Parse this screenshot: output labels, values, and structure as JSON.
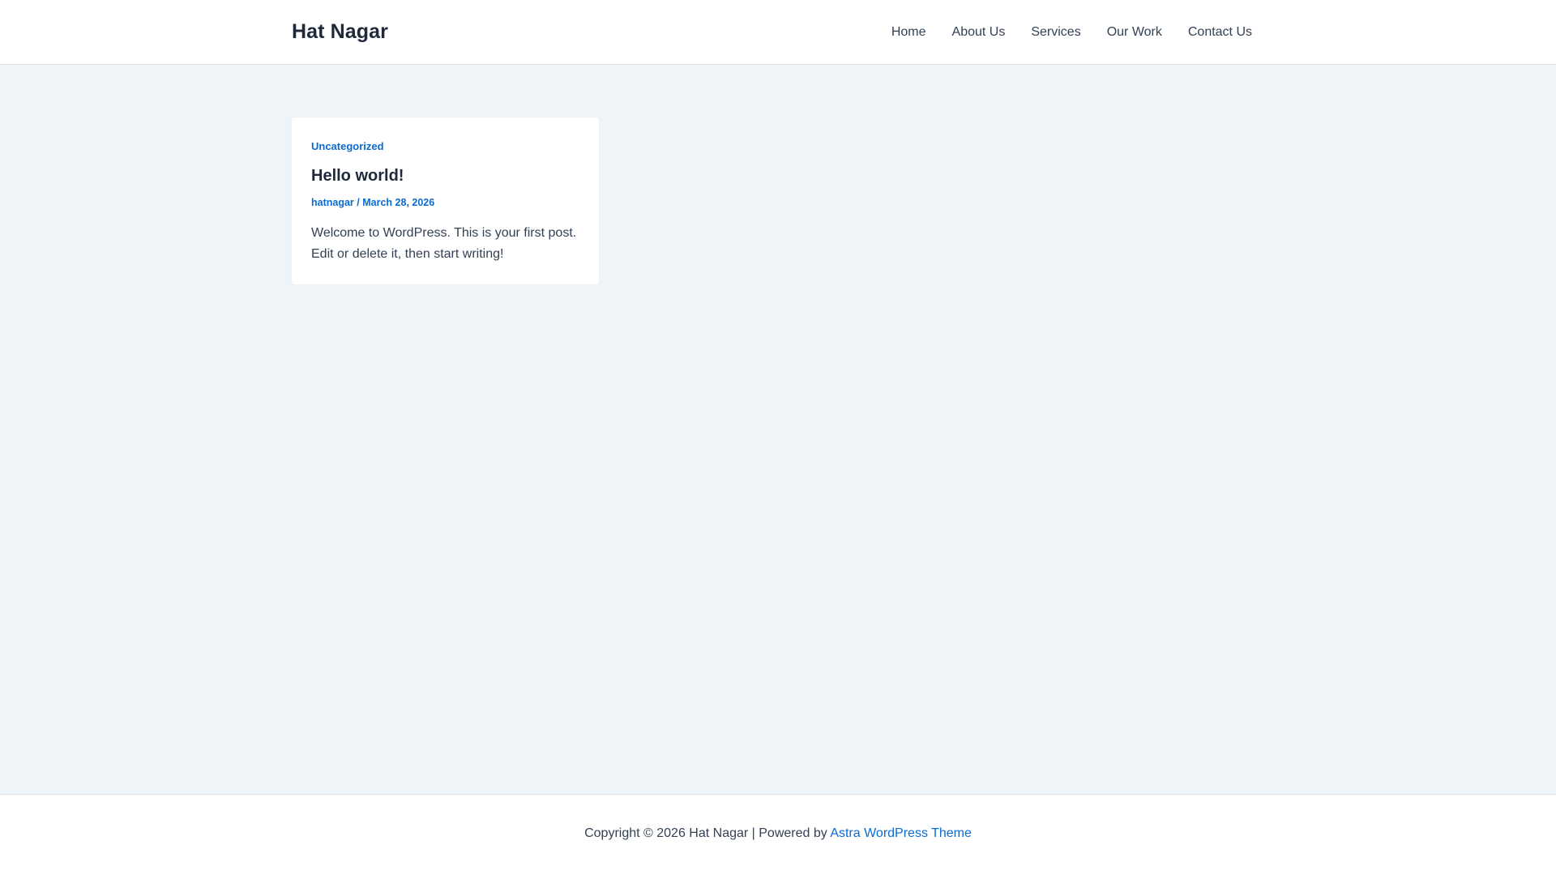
{
  "header": {
    "site_title": "Hat Nagar",
    "nav": [
      {
        "label": "Home"
      },
      {
        "label": "About Us"
      },
      {
        "label": "Services"
      },
      {
        "label": "Our Work"
      },
      {
        "label": "Contact Us"
      }
    ]
  },
  "post": {
    "category": "Uncategorized",
    "title": "Hello world!",
    "author": "hatnagar",
    "separator": "/",
    "date": "March 28, 2026",
    "excerpt": "Welcome to WordPress. This is your first post. Edit or delete it, then start writing!"
  },
  "footer": {
    "copyright": "Copyright © 2026 Hat Nagar | Powered by",
    "theme_link": "Astra WordPress Theme"
  },
  "colors": {
    "accent": "#0a6bd1",
    "heading": "#1e293b",
    "text": "#334155",
    "background": "#eff4f8"
  }
}
